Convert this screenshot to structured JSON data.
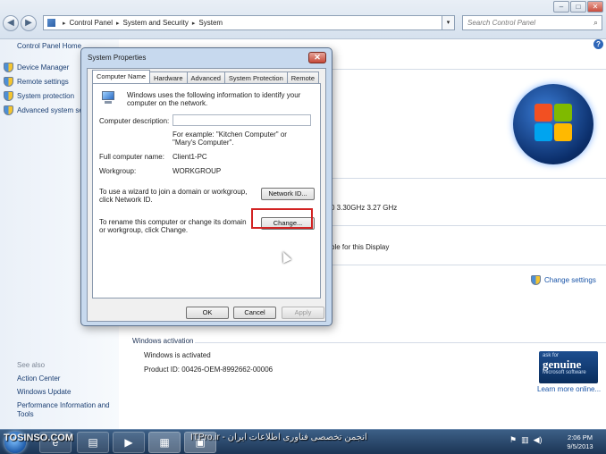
{
  "window": {
    "controls": {
      "minimize": "–",
      "maximize": "□",
      "close": "✕"
    }
  },
  "nav": {
    "back": "◀",
    "forward": "▶",
    "breadcrumb": [
      "Control Panel",
      "System and Security",
      "System"
    ],
    "search_placeholder": "Search Control Panel"
  },
  "left_pane": {
    "home": "Control Panel Home",
    "tasks": [
      "Device Manager",
      "Remote settings",
      "System protection",
      "Advanced system settings"
    ],
    "see_also": "See also",
    "links": [
      "Action Center",
      "Windows Update",
      "Performance Information and Tools"
    ]
  },
  "main": {
    "fragments": [
      "0 3.30GHz   3.27 GHz",
      "ble for this Display"
    ],
    "change_settings": "Change settings",
    "activation_section": "Windows activation",
    "activation_status": "Windows is activated",
    "product_id": "Product ID: 00426-OEM-8992662-00006",
    "genuine_badge": {
      "top": "ask for",
      "brand": "genuine",
      "mid": "Microsoft",
      "bottom": "software"
    },
    "learn_more": "Learn more online..."
  },
  "dialog": {
    "title": "System Properties",
    "tabs": [
      "Computer Name",
      "Hardware",
      "Advanced",
      "System Protection",
      "Remote"
    ],
    "active_tab": "Computer Name",
    "intro": "Windows uses the following information to identify your computer on the network.",
    "computer_description_label": "Computer description:",
    "computer_description_value": "",
    "example": "For example: \"Kitchen Computer\" or \"Mary's Computer\".",
    "full_name_label": "Full computer name:",
    "full_name_value": "Client1-PC",
    "workgroup_label": "Workgroup:",
    "workgroup_value": "WORKGROUP",
    "network_text": "To use a wizard to join a domain or workgroup, click Network ID.",
    "network_button": "Network ID...",
    "rename_text": "To rename this computer or change its domain or workgroup, click Change.",
    "change_button": "Change...",
    "ok": "OK",
    "cancel": "Cancel",
    "apply": "Apply"
  },
  "taskbar": {
    "watermark": "TOSINSO.COM",
    "watermark_site": "ITPro.ir - انجمن تخصصی فناوری اطلاعات ایران",
    "time": "2:06 PM",
    "date": "9/5/2013"
  }
}
